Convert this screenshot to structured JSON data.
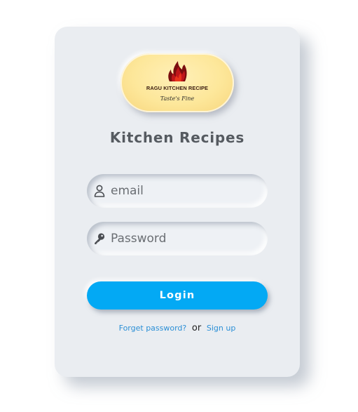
{
  "logo": {
    "name": "RAGU KITCHEN RECIPE",
    "tagline": "Taste's Fine",
    "flame_colors": [
      "#7a0e0e",
      "#c0161a",
      "#e8341c"
    ]
  },
  "title": "Kitchen Recipes",
  "form": {
    "email": {
      "placeholder": "email",
      "value": "",
      "icon": "user-icon"
    },
    "password": {
      "placeholder": "Password",
      "value": "",
      "icon": "key-icon"
    },
    "login_label": "Login"
  },
  "links": {
    "forgot_password": "Forget password?",
    "separator": "or",
    "sign_up": "Sign up"
  },
  "colors": {
    "card_background": "#eaedf1",
    "accent": "#03a9f4",
    "link": "#2b8fd6",
    "title": "#555a60"
  }
}
